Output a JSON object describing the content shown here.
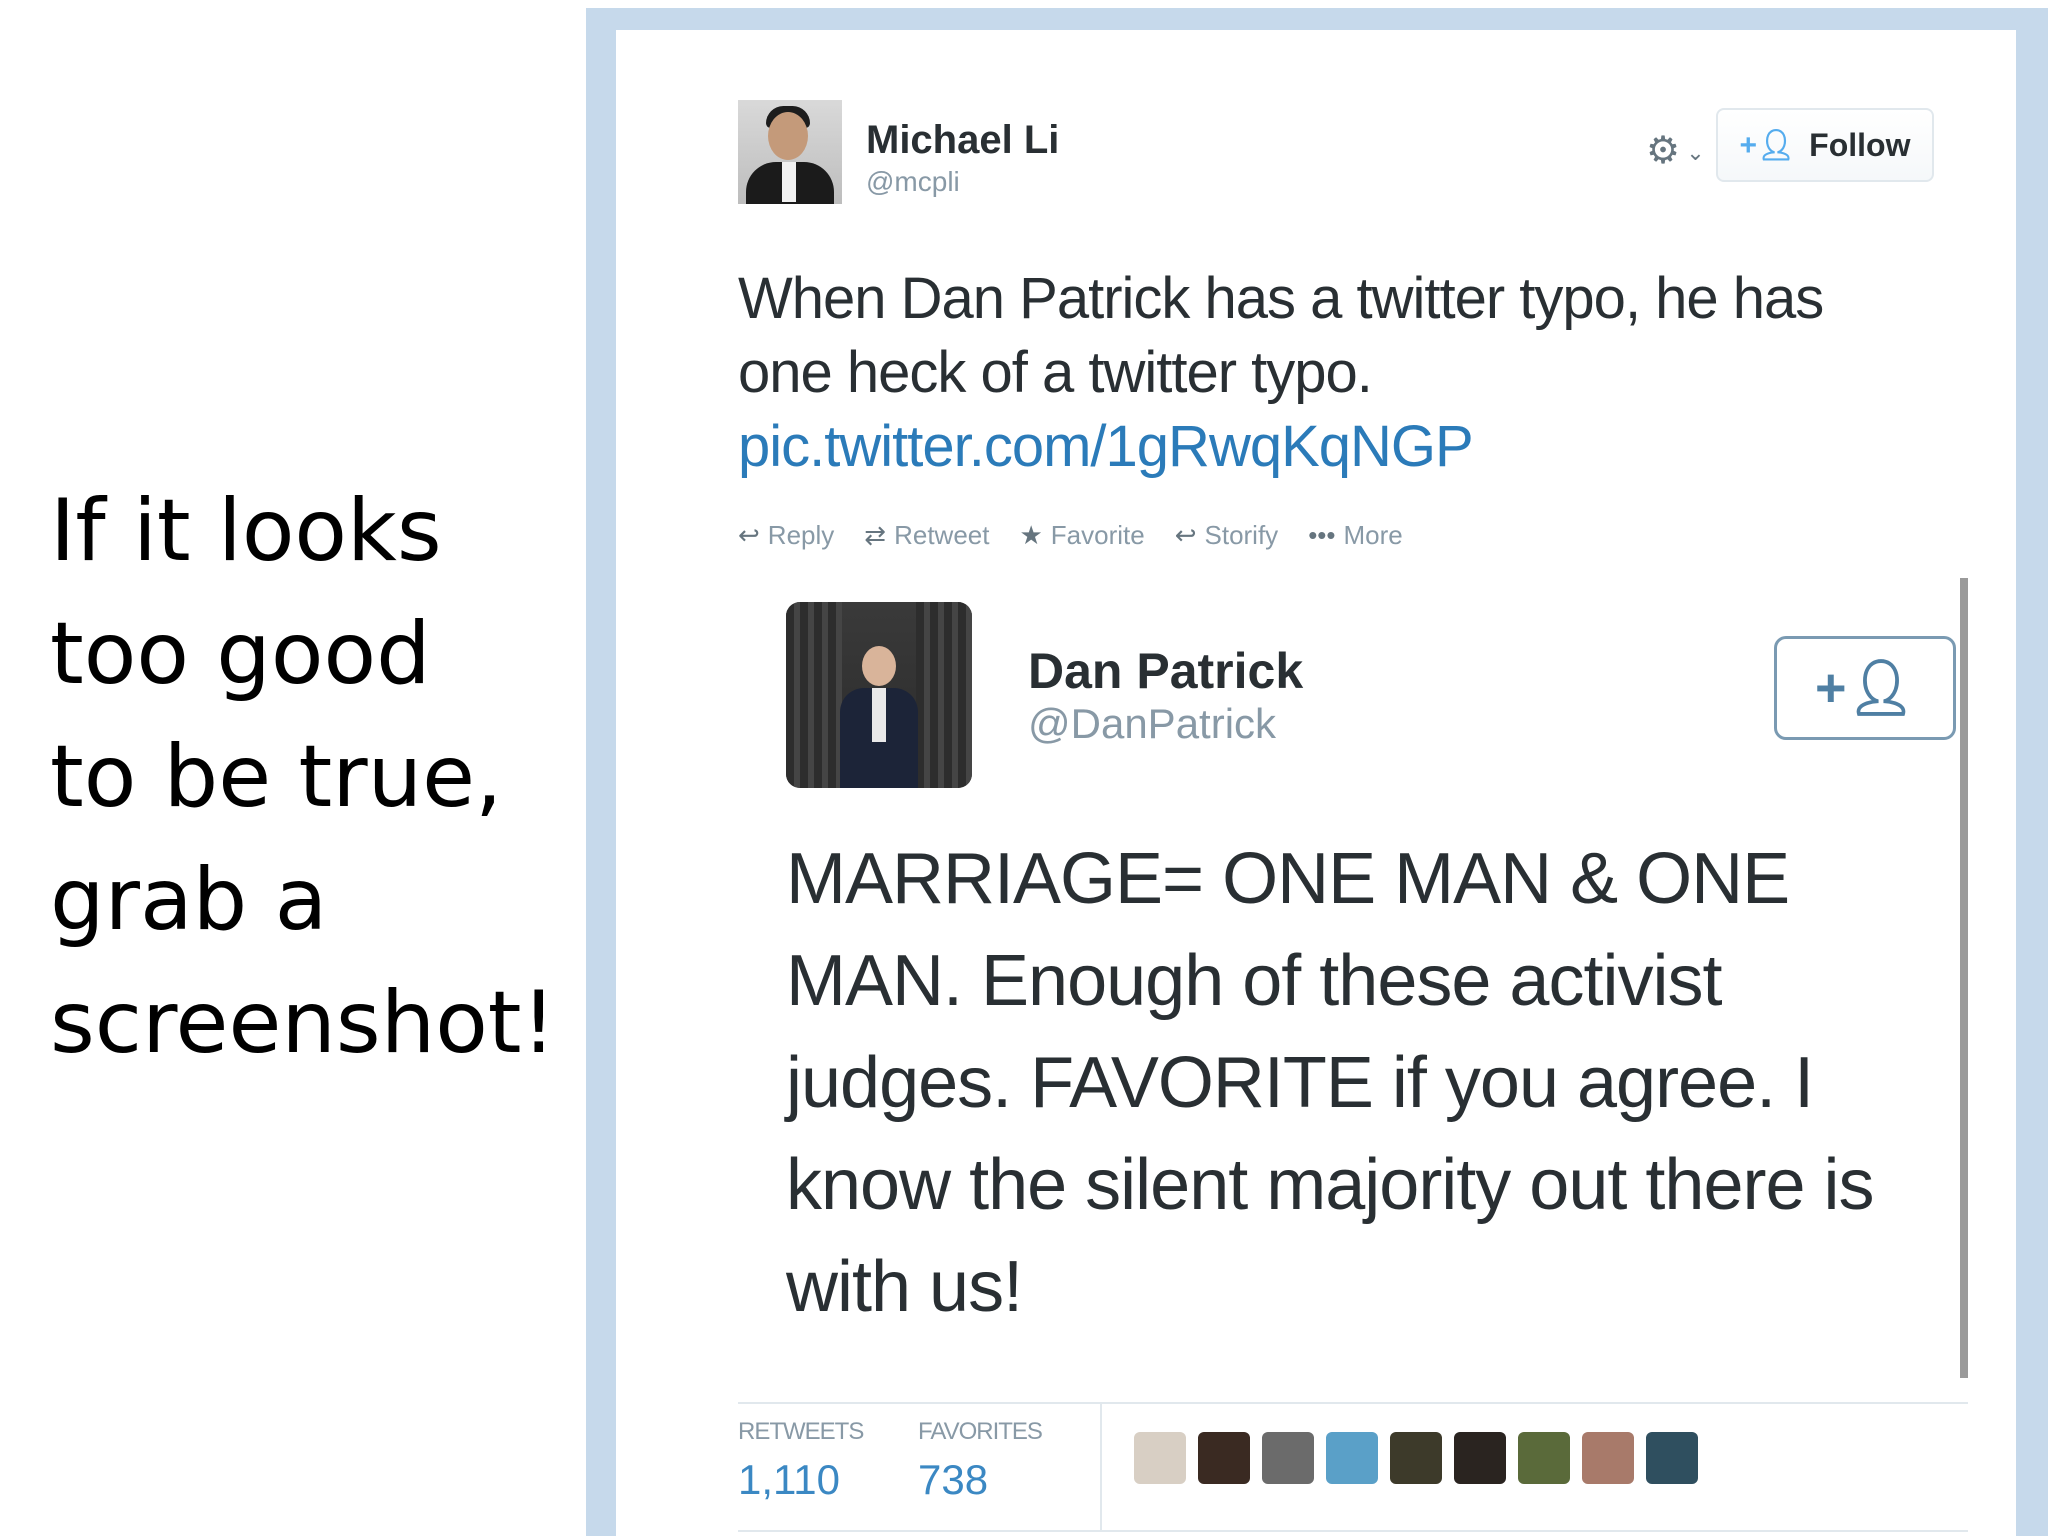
{
  "caption": {
    "lines": [
      "If it looks",
      "too good",
      "to be true,",
      "grab a",
      "screenshot!"
    ]
  },
  "tweet": {
    "author_name": "Michael Li",
    "author_handle": "@mcpli",
    "follow_label": "Follow",
    "text": "When Dan Patrick has a twitter typo, he has one heck of a twitter typo.",
    "link": "pic.twitter.com/1gRwqKqNGP",
    "actions": [
      {
        "icon": "reply-icon",
        "glyph": "↩",
        "label": "Reply"
      },
      {
        "icon": "retweet-icon",
        "glyph": "⇄",
        "label": "Retweet"
      },
      {
        "icon": "favorite-icon",
        "glyph": "★",
        "label": "Favorite"
      },
      {
        "icon": "storify-icon",
        "glyph": "↩",
        "label": "Storify"
      },
      {
        "icon": "more-icon",
        "glyph": "•••",
        "label": "More"
      }
    ]
  },
  "embedded_tweet": {
    "author_name": "Dan Patrick",
    "author_handle": "@DanPatrick",
    "text": "MARRIAGE= ONE MAN & ONE MAN. Enough of these activist judges. FAVORITE if you agree. I know the silent majority out there is with us!"
  },
  "stats": {
    "retweets_label": "RETWEETS",
    "retweets_value": "1,110",
    "favorites_label": "FAVORITES",
    "favorites_value": "738",
    "favoriter_avatar_colors": [
      "#d8cfc4",
      "#3a2a22",
      "#6b6b6b",
      "#5aa0c8",
      "#3d3a2a",
      "#2a2420",
      "#5a6a3a",
      "#a87a6a",
      "#2f4f5f"
    ]
  },
  "colors": {
    "link": "#2b7bb9",
    "frame": "#c6d9eb",
    "accent": "#55acee"
  }
}
